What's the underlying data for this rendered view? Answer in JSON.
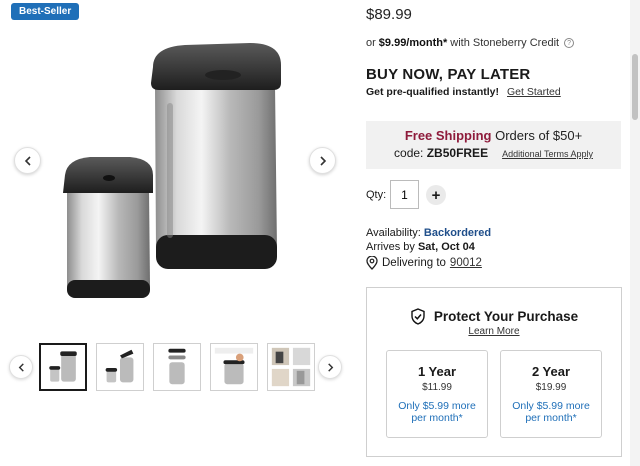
{
  "badge": "Best-Seller",
  "product": {
    "price": "$89.99",
    "credit": {
      "prefix": "or",
      "monthly": "$9.99/month*",
      "suffix": "with Stoneberry Credit",
      "info_icon": "?"
    },
    "bnpl": {
      "title": "BUY NOW, PAY LATER",
      "subtitle": "Get pre-qualified instantly!",
      "link": "Get Started"
    },
    "shipping": {
      "free_label": "Free Shipping",
      "condition": "Orders of $50+",
      "code_label": "code:",
      "code": "ZB50FREE",
      "terms_link": "Additional Terms Apply"
    },
    "qty": {
      "label": "Qty:",
      "value": "1",
      "plus": "+"
    },
    "availability": {
      "label": "Availability:",
      "status": "Backordered"
    },
    "arrives": {
      "label": "Arrives by",
      "date": "Sat, Oct 04"
    },
    "delivery": {
      "label": "Delivering to",
      "zip": "90012"
    }
  },
  "protection": {
    "title": "Protect Your Purchase",
    "learn_more": "Learn More",
    "plans": [
      {
        "term": "1 Year",
        "price": "$11.99",
        "monthly": "Only $5.99 more per month*"
      },
      {
        "term": "2 Year",
        "price": "$19.99",
        "monthly": "Only $5.99 more per month*"
      }
    ]
  },
  "colors": {
    "accent": "#1f6fb8",
    "free_shipping": "#8e1b3b",
    "status": "#1f4e8a"
  },
  "icons": [
    "chevron-left-icon",
    "chevron-right-icon",
    "info-icon",
    "plus-icon",
    "location-pin-icon",
    "shield-check-icon"
  ]
}
